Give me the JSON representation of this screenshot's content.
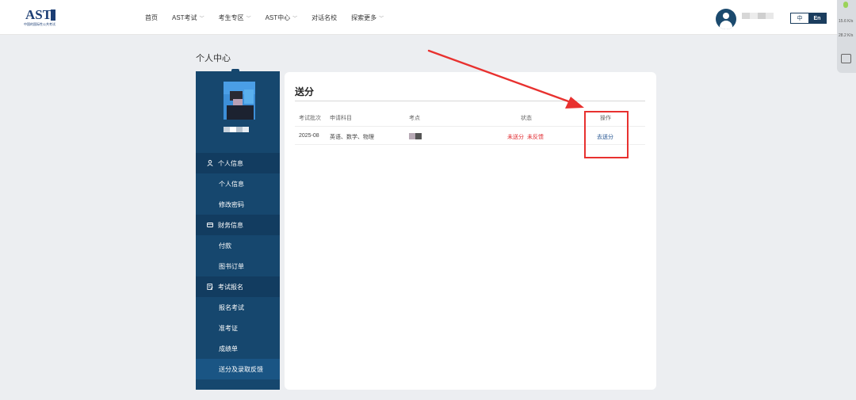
{
  "header": {
    "logo_text": "AST",
    "logo_sub": "中国的国际性公共考试",
    "nav": [
      {
        "label": "首页",
        "has_dropdown": false
      },
      {
        "label": "AST考试",
        "has_dropdown": true
      },
      {
        "label": "考生专区",
        "has_dropdown": true
      },
      {
        "label": "AST中心",
        "has_dropdown": true
      },
      {
        "label": "对话名校",
        "has_dropdown": false
      },
      {
        "label": "探索更多",
        "has_dropdown": true
      }
    ],
    "lang_cn": "中",
    "lang_en": "En"
  },
  "float_widget": {
    "line1": "15.6 K/s",
    "line2": "28.2 K/s"
  },
  "page_title": "个人中心",
  "sidebar": {
    "groups": [
      {
        "label": "个人信息",
        "icon": "user-icon",
        "items": [
          "个人信息",
          "修改密码"
        ]
      },
      {
        "label": "财务信息",
        "icon": "card-icon",
        "items": [
          "付款",
          "图书订单"
        ]
      },
      {
        "label": "考试报名",
        "icon": "form-icon",
        "items": [
          "报名考试",
          "准考证",
          "成绩单",
          "送分及录取反馈"
        ]
      }
    ],
    "active_item": "送分及录取反馈"
  },
  "main": {
    "title": "送分",
    "columns": [
      "考试批次",
      "申请科目",
      "考点",
      "状态",
      "操作"
    ],
    "rows": [
      {
        "batch": "2025-08",
        "subjects": "英语、数学、物理",
        "status_1": "未送分",
        "status_2": "未反馈",
        "action": "去送分"
      }
    ]
  },
  "colors": {
    "sidebar": "#16476e",
    "sidebar_group": "#123c60",
    "accent_red": "#e0292f",
    "link_blue": "#1e4f8e",
    "annotation_red": "#e8312f"
  }
}
